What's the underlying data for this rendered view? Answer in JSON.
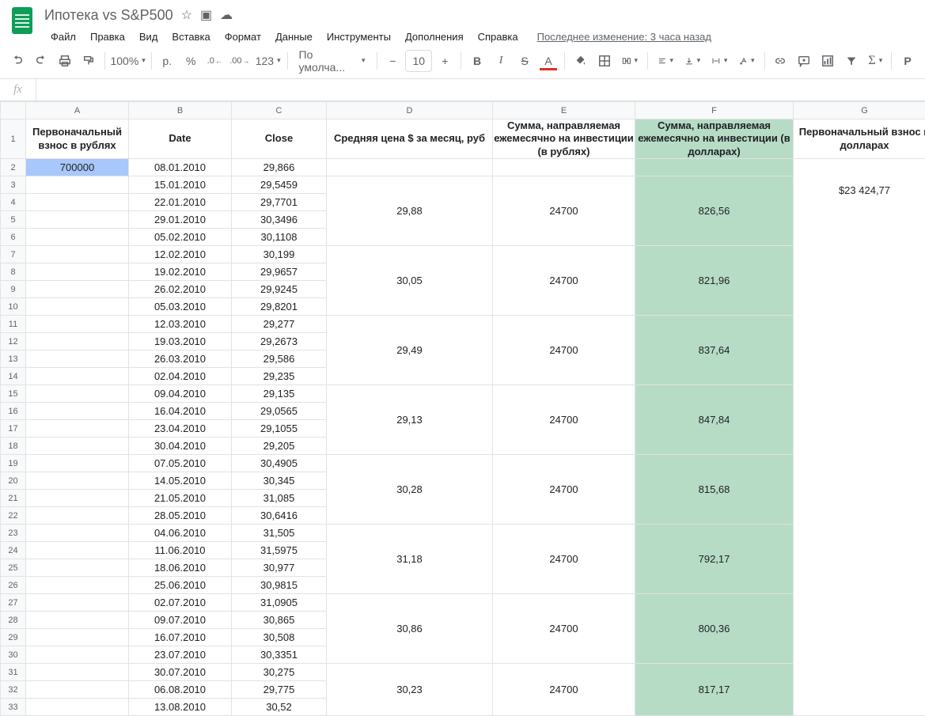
{
  "header": {
    "doc_title": "Ипотека vs S&P500",
    "icons": {
      "star": "☆",
      "drive": "▣",
      "cloud": "☁"
    },
    "last_change": "Последнее изменение: 3 часа назад"
  },
  "menu": [
    "Файл",
    "Правка",
    "Вид",
    "Вставка",
    "Формат",
    "Данные",
    "Инструменты",
    "Дополнения",
    "Справка"
  ],
  "toolbar": {
    "zoom": "100%",
    "currency": "р.",
    "percent": "%",
    "dec_dec": ".0",
    "dec_inc": ".00",
    "num_fmt": "123",
    "font": "По умолча...",
    "font_size": "10",
    "bold": "B",
    "italic": "I",
    "strike": "S",
    "textcolor": "A",
    "more": "Р"
  },
  "formula_bar": {
    "label": "fx",
    "value": ""
  },
  "columns": [
    "A",
    "B",
    "C",
    "D",
    "E",
    "F",
    "G"
  ],
  "col_headers": {
    "A": "Первоначальный взнос в рублях",
    "B": "Date",
    "C": "Close",
    "D": "Средняя цена $ за месяц, руб",
    "E": "Сумма, направляемая ежемесячно на инвестиции (в рублях)",
    "F": "Сумма, направляемая ежемесячно на инвестиции (в долларах)",
    "G": "Первоначальный взнос в долларах"
  },
  "rows": [
    {
      "n": 2,
      "A": "700000",
      "B": "08.01.2010",
      "C": "29,866",
      "selected_A": true
    },
    {
      "n": 3,
      "B": "15.01.2010",
      "C": "29,5459",
      "D": "29,88",
      "E": "24700",
      "F": "826,56",
      "G": "$23 424,77",
      "merge_start": true,
      "merge_rows": 4
    },
    {
      "n": 4,
      "B": "22.01.2010",
      "C": "29,7701"
    },
    {
      "n": 5,
      "B": "29.01.2010",
      "C": "30,3496"
    },
    {
      "n": 6,
      "B": "05.02.2010",
      "C": "30,1108"
    },
    {
      "n": 7,
      "B": "12.02.2010",
      "C": "30,199",
      "D": "30,05",
      "E": "24700",
      "F": "821,96",
      "merge_start": true,
      "merge_rows": 4
    },
    {
      "n": 8,
      "B": "19.02.2010",
      "C": "29,9657"
    },
    {
      "n": 9,
      "B": "26.02.2010",
      "C": "29,9245"
    },
    {
      "n": 10,
      "B": "05.03.2010",
      "C": "29,8201"
    },
    {
      "n": 11,
      "B": "12.03.2010",
      "C": "29,277",
      "D": "29,49",
      "E": "24700",
      "F": "837,64",
      "merge_start": true,
      "merge_rows": 4
    },
    {
      "n": 12,
      "B": "19.03.2010",
      "C": "29,2673"
    },
    {
      "n": 13,
      "B": "26.03.2010",
      "C": "29,586"
    },
    {
      "n": 14,
      "B": "02.04.2010",
      "C": "29,235"
    },
    {
      "n": 15,
      "B": "09.04.2010",
      "C": "29,135",
      "D": "29,13",
      "E": "24700",
      "F": "847,84",
      "merge_start": true,
      "merge_rows": 4
    },
    {
      "n": 16,
      "B": "16.04.2010",
      "C": "29,0565"
    },
    {
      "n": 17,
      "B": "23.04.2010",
      "C": "29,1055"
    },
    {
      "n": 18,
      "B": "30.04.2010",
      "C": "29,205"
    },
    {
      "n": 19,
      "B": "07.05.2010",
      "C": "30,4905",
      "D": "30,28",
      "E": "24700",
      "F": "815,68",
      "merge_start": true,
      "merge_rows": 4
    },
    {
      "n": 20,
      "B": "14.05.2010",
      "C": "30,345"
    },
    {
      "n": 21,
      "B": "21.05.2010",
      "C": "31,085"
    },
    {
      "n": 22,
      "B": "28.05.2010",
      "C": "30,6416"
    },
    {
      "n": 23,
      "B": "04.06.2010",
      "C": "31,505",
      "D": "31,18",
      "E": "24700",
      "F": "792,17",
      "merge_start": true,
      "merge_rows": 4
    },
    {
      "n": 24,
      "B": "11.06.2010",
      "C": "31,5975"
    },
    {
      "n": 25,
      "B": "18.06.2010",
      "C": "30,977"
    },
    {
      "n": 26,
      "B": "25.06.2010",
      "C": "30,9815"
    },
    {
      "n": 27,
      "B": "02.07.2010",
      "C": "31,0905",
      "D": "30,86",
      "E": "24700",
      "F": "800,36",
      "merge_start": true,
      "merge_rows": 4
    },
    {
      "n": 28,
      "B": "09.07.2010",
      "C": "30,865"
    },
    {
      "n": 29,
      "B": "16.07.2010",
      "C": "30,508"
    },
    {
      "n": 30,
      "B": "23.07.2010",
      "C": "30,3351"
    },
    {
      "n": 31,
      "B": "30.07.2010",
      "C": "30,275",
      "D": "30,23",
      "E": "24700",
      "F": "817,17",
      "merge_start": true,
      "merge_rows": 4
    },
    {
      "n": 32,
      "B": "06.08.2010",
      "C": "29,775"
    },
    {
      "n": 33,
      "B": "13.08.2010",
      "C": "30,52"
    }
  ]
}
